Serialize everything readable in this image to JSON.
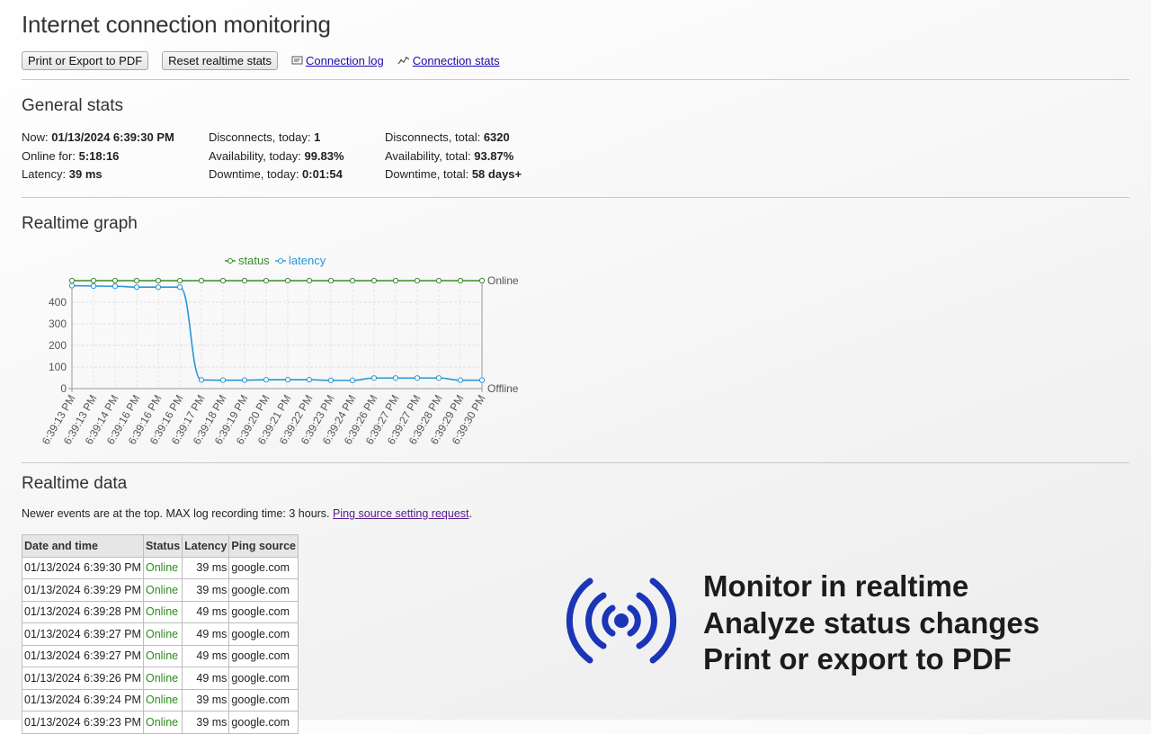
{
  "page": {
    "title": "Internet connection monitoring"
  },
  "toolbar": {
    "print_label": "Print or Export to PDF",
    "reset_label": "Reset realtime stats",
    "log_link": "Connection log",
    "stats_link": "Connection stats"
  },
  "general": {
    "title": "General stats",
    "now_label": "Now: ",
    "now_value": "01/13/2024 6:39:30 PM",
    "online_label": "Online for: ",
    "online_value": "5:18:16",
    "latency_label": "Latency: ",
    "latency_value": "39 ms",
    "disc_today_label": "Disconnects, today: ",
    "disc_today_value": "1",
    "avail_today_label": "Availability, today: ",
    "avail_today_value": "99.83%",
    "down_today_label": "Downtime, today: ",
    "down_today_value": "0:01:54",
    "disc_total_label": "Disconnects, total: ",
    "disc_total_value": "6320",
    "avail_total_label": "Availability, total: ",
    "avail_total_value": "93.87%",
    "down_total_label": "Downtime, total: ",
    "down_total_value": "58 days+"
  },
  "graph_section": {
    "title": "Realtime graph"
  },
  "chart_data": {
    "type": "line",
    "categories": [
      "6:39:13 PM",
      "6:39:13 PM",
      "6:39:14 PM",
      "6:39:16 PM",
      "6:39:16 PM",
      "6:39:16 PM",
      "6:39:17 PM",
      "6:39:18 PM",
      "6:39:19 PM",
      "6:39:20 PM",
      "6:39:21 PM",
      "6:39:22 PM",
      "6:39:23 PM",
      "6:39:24 PM",
      "6:39:26 PM",
      "6:39:27 PM",
      "6:39:27 PM",
      "6:39:28 PM",
      "6:39:29 PM",
      "6:39:30 PM"
    ],
    "series": [
      {
        "name": "status",
        "color": "#3a8a2e",
        "axis": "right",
        "values": [
          "Online",
          "Online",
          "Online",
          "Online",
          "Online",
          "Online",
          "Online",
          "Online",
          "Online",
          "Online",
          "Online",
          "Online",
          "Online",
          "Online",
          "Online",
          "Online",
          "Online",
          "Online",
          "Online",
          "Online"
        ]
      },
      {
        "name": "latency",
        "color": "#2a96d6",
        "axis": "left",
        "values": [
          477,
          475,
          474,
          470,
          470,
          470,
          40,
          39,
          39,
          41,
          41,
          41,
          38,
          38,
          49,
          49,
          49,
          49,
          39,
          39
        ]
      }
    ],
    "yticks": [
      "0",
      "100",
      "200",
      "300",
      "400"
    ],
    "ylim": [
      0,
      500
    ],
    "y2ticks": [
      "Offline",
      "Online"
    ],
    "legend": "top",
    "grid": true
  },
  "data_section": {
    "title": "Realtime data",
    "note": "Newer events are at the top. MAX log recording time: 3 hours. ",
    "note_link": "Ping source setting request",
    "note_end": "."
  },
  "table": {
    "headers": [
      "Date and time",
      "Status",
      "Latency",
      "Ping source"
    ],
    "rows": [
      [
        "01/13/2024 6:39:30 PM",
        "Online",
        "39 ms",
        "google.com"
      ],
      [
        "01/13/2024 6:39:29 PM",
        "Online",
        "39 ms",
        "google.com"
      ],
      [
        "01/13/2024 6:39:28 PM",
        "Online",
        "49 ms",
        "google.com"
      ],
      [
        "01/13/2024 6:39:27 PM",
        "Online",
        "49 ms",
        "google.com"
      ],
      [
        "01/13/2024 6:39:27 PM",
        "Online",
        "49 ms",
        "google.com"
      ],
      [
        "01/13/2024 6:39:26 PM",
        "Online",
        "49 ms",
        "google.com"
      ],
      [
        "01/13/2024 6:39:24 PM",
        "Online",
        "39 ms",
        "google.com"
      ],
      [
        "01/13/2024 6:39:23 PM",
        "Online",
        "39 ms",
        "google.com"
      ]
    ]
  },
  "promo": {
    "icon": "broadcast-signal-icon",
    "lines": [
      "Monitor in realtime",
      "Analyze status changes",
      "Print or export to PDF"
    ]
  },
  "colors": {
    "promo_icon": "#1b35b8",
    "online": "#2e8b1f",
    "link": "#1a0dab"
  }
}
